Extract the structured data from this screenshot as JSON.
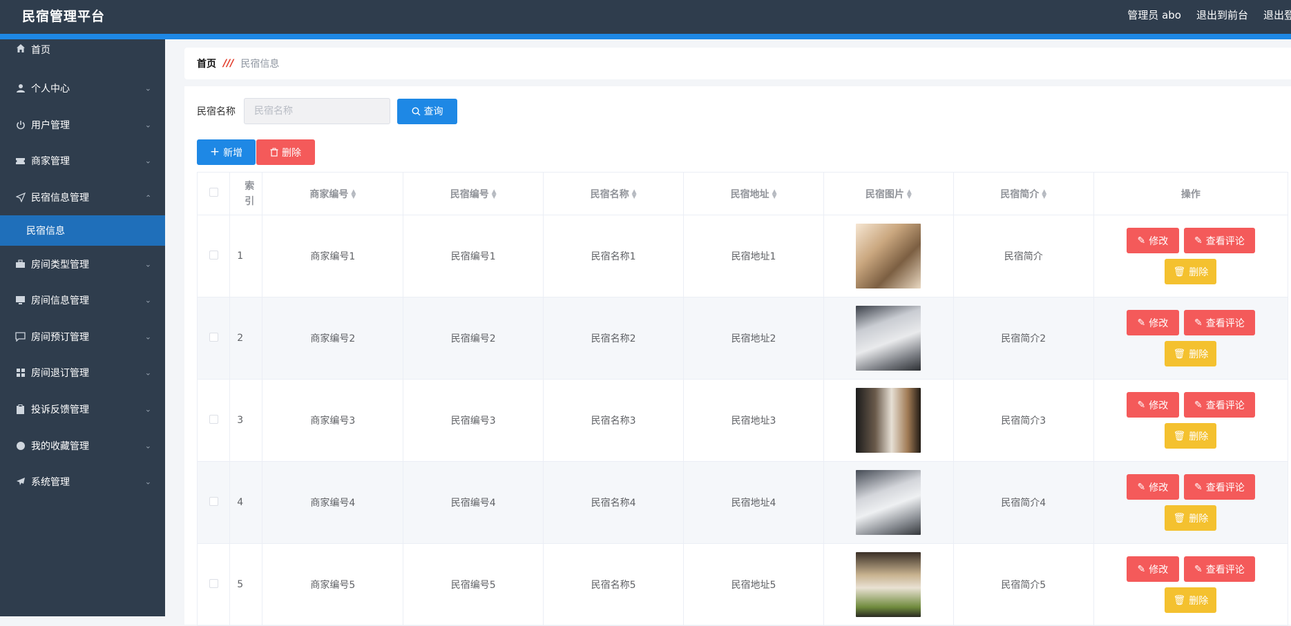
{
  "header": {
    "title": "民宿管理平台",
    "user_label": "管理员 abo",
    "exit_front_label": "退出到前台",
    "logout_label": "退出登录"
  },
  "sidebar": {
    "items": [
      {
        "label": "首页",
        "icon": "home-icon",
        "has_chevron": false
      },
      {
        "label": "个人中心",
        "icon": "user-icon",
        "has_chevron": true
      },
      {
        "label": "用户管理",
        "icon": "power-icon",
        "has_chevron": true
      },
      {
        "label": "商家管理",
        "icon": "ticket-icon",
        "has_chevron": true
      },
      {
        "label": "民宿信息管理",
        "icon": "send-icon",
        "has_chevron": true,
        "expanded": true
      },
      {
        "label": "房间类型管理",
        "icon": "briefcase-icon",
        "has_chevron": true
      },
      {
        "label": "房间信息管理",
        "icon": "monitor-icon",
        "has_chevron": true
      },
      {
        "label": "房间预订管理",
        "icon": "chat-icon",
        "has_chevron": true
      },
      {
        "label": "房间退订管理",
        "icon": "grid-icon",
        "has_chevron": true
      },
      {
        "label": "投诉反馈管理",
        "icon": "clipboard-icon",
        "has_chevron": true
      },
      {
        "label": "我的收藏管理",
        "icon": "pin-icon",
        "has_chevron": true
      },
      {
        "label": "系统管理",
        "icon": "paper-plane-icon",
        "has_chevron": true
      }
    ],
    "sub_item": "民宿信息"
  },
  "breadcrumb": {
    "home": "首页",
    "current": "民宿信息"
  },
  "search": {
    "label": "民宿名称",
    "placeholder": "民宿名称",
    "query_label": "查询"
  },
  "actions": {
    "add_label": "新增",
    "delete_label": "删除"
  },
  "table": {
    "headers": [
      "索引",
      "商家编号",
      "民宿编号",
      "民宿名称",
      "民宿地址",
      "民宿图片",
      "民宿简介",
      "操作"
    ],
    "rows": [
      {
        "index": "1",
        "merchant_no": "商家编号1",
        "homestay_no": "民宿编号1",
        "name": "民宿名称1",
        "address": "民宿地址1",
        "intro": "民宿简介"
      },
      {
        "index": "2",
        "merchant_no": "商家编号2",
        "homestay_no": "民宿编号2",
        "name": "民宿名称2",
        "address": "民宿地址2",
        "intro": "民宿简介2"
      },
      {
        "index": "3",
        "merchant_no": "商家编号3",
        "homestay_no": "民宿编号3",
        "name": "民宿名称3",
        "address": "民宿地址3",
        "intro": "民宿简介3"
      },
      {
        "index": "4",
        "merchant_no": "商家编号4",
        "homestay_no": "民宿编号4",
        "name": "民宿名称4",
        "address": "民宿地址4",
        "intro": "民宿简介4"
      },
      {
        "index": "5",
        "merchant_no": "商家编号5",
        "homestay_no": "民宿编号5",
        "name": "民宿名称5",
        "address": "民宿地址5",
        "intro": "民宿简介5"
      }
    ],
    "edit_label": "修改",
    "view_comments_label": "查看评论",
    "row_delete_label": "删除"
  },
  "colors": {
    "header_bg": "#2f3d4d",
    "accent": "#1e88e5",
    "danger": "#f45a5a",
    "warning": "#f4c12f",
    "active_sub": "#1f6fba"
  }
}
